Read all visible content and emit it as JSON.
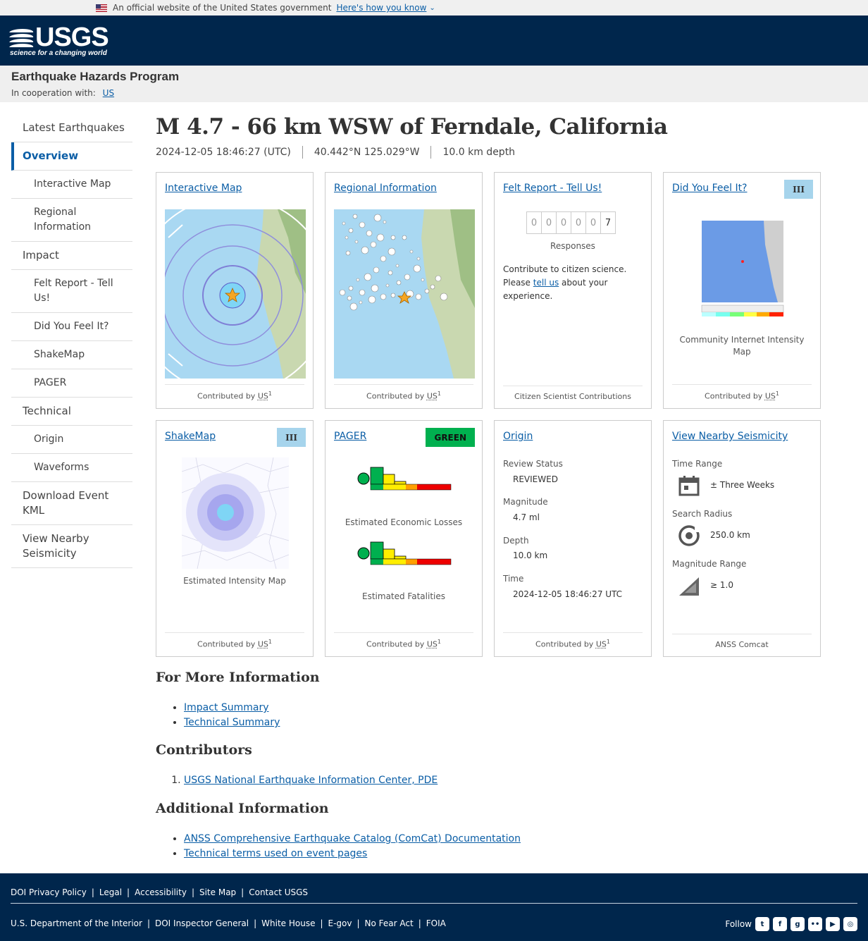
{
  "gov_banner": {
    "text": "An official website of the United States government",
    "link": "Here's how you know"
  },
  "logo": {
    "word": "USGS",
    "tagline": "science for a changing world"
  },
  "program": {
    "title": "Earthquake Hazards Program",
    "coop_label": "In cooperation with:",
    "coop_link": "US"
  },
  "sidebar": {
    "items": [
      {
        "label": "Latest Earthquakes",
        "level": 0
      },
      {
        "label": "Overview",
        "level": 0,
        "active": true
      },
      {
        "label": "Interactive Map",
        "level": 1
      },
      {
        "label": "Regional Information",
        "level": 1
      },
      {
        "label": "Impact",
        "level": 0
      },
      {
        "label": "Felt Report - Tell Us!",
        "level": 1
      },
      {
        "label": "Did You Feel It?",
        "level": 1
      },
      {
        "label": "ShakeMap",
        "level": 1
      },
      {
        "label": "PAGER",
        "level": 1
      },
      {
        "label": "Technical",
        "level": 0
      },
      {
        "label": "Origin",
        "level": 1
      },
      {
        "label": "Waveforms",
        "level": 1
      },
      {
        "label": "Download Event KML",
        "level": 0
      },
      {
        "label": "View Nearby Seismicity",
        "level": 0
      }
    ]
  },
  "event": {
    "title": "M 4.7 - 66 km WSW of Ferndale, California",
    "time": "2024-12-05 18:46:27 (UTC)",
    "location": "40.442°N 125.029°W",
    "depth": "10.0 km depth"
  },
  "contributed": {
    "text": "Contributed by",
    "abbr": "US",
    "sup": "1"
  },
  "cards": {
    "interactive_map": {
      "title": "Interactive Map"
    },
    "regional": {
      "title": "Regional Information"
    },
    "felt": {
      "title": "Felt Report - Tell Us!",
      "digits": [
        "0",
        "0",
        "0",
        "0",
        "0",
        "7"
      ],
      "responses_label": "Responses",
      "text_before": "Contribute to citizen science. Please",
      "link": "tell us",
      "text_after": "about your experience.",
      "footer": "Citizen Scientist Contributions"
    },
    "dyfi": {
      "title": "Did You Feel It?",
      "badge": "III",
      "caption": "Community Internet Intensity Map"
    },
    "shakemap": {
      "title": "ShakeMap",
      "badge": "III",
      "caption": "Estimated Intensity Map"
    },
    "pager": {
      "title": "PAGER",
      "badge": "GREEN",
      "losses_caption": "Estimated Economic Losses",
      "fatalities_caption": "Estimated Fatalities"
    },
    "origin": {
      "title": "Origin",
      "fields": [
        {
          "label": "Review Status",
          "value": "REVIEWED"
        },
        {
          "label": "Magnitude",
          "value": "4.7 ml"
        },
        {
          "label": "Depth",
          "value": "10.0 km"
        },
        {
          "label": "Time",
          "value": "2024-12-05 18:46:27 UTC"
        }
      ]
    },
    "nearby": {
      "title": "View Nearby Seismicity",
      "fields": [
        {
          "label": "Time Range",
          "value": "± Three Weeks",
          "icon": "calendar-icon"
        },
        {
          "label": "Search Radius",
          "value": "250.0 km",
          "icon": "radius-target-icon"
        },
        {
          "label": "Magnitude Range",
          "value": "≥ 1.0",
          "icon": "magnitude-ramp-icon"
        }
      ],
      "footer": "ANSS Comcat"
    }
  },
  "more_info": {
    "heading": "For More Information",
    "links": [
      "Impact Summary",
      "Technical Summary"
    ]
  },
  "contributors": {
    "heading": "Contributors",
    "items": [
      "USGS National Earthquake Information Center, PDE"
    ]
  },
  "additional": {
    "heading": "Additional Information",
    "links": [
      "ANSS Comprehensive Earthquake Catalog (ComCat) Documentation",
      "Technical terms used on event pages"
    ]
  },
  "footer": {
    "row1": [
      "DOI Privacy Policy",
      "Legal",
      "Accessibility",
      "Site Map",
      "Contact USGS"
    ],
    "row2": [
      "U.S. Department of the Interior",
      "DOI Inspector General",
      "White House",
      "E-gov",
      "No Fear Act",
      "FOIA"
    ],
    "follow": "Follow",
    "social": [
      {
        "icon": "twitter-icon",
        "glyph": "t"
      },
      {
        "icon": "facebook-icon",
        "glyph": "f"
      },
      {
        "icon": "github-icon",
        "glyph": "g"
      },
      {
        "icon": "flickr-icon",
        "glyph": "••"
      },
      {
        "icon": "youtube-icon",
        "glyph": "▶"
      },
      {
        "icon": "instagram-icon",
        "glyph": "◎"
      }
    ]
  },
  "colors": {
    "nav_blue": "#00264c",
    "link": "#0b5ea6",
    "pager_green": "#00b04f",
    "mmi_III": "#a6d4ec"
  }
}
